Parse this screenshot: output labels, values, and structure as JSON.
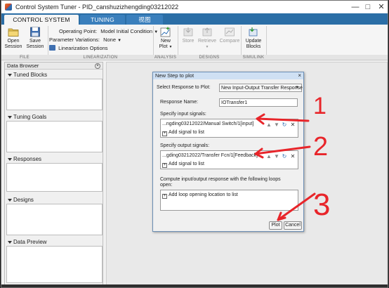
{
  "window": {
    "title": "Control System Tuner - PID_canshuzizhengding03212022"
  },
  "tabs": [
    "CONTROL SYSTEM",
    "TUNING",
    "视图"
  ],
  "toolstrip": {
    "open_session": "Open\nSession",
    "save_session": "Save\nSession",
    "operating_point_label": "Operating Point:",
    "operating_point_value": "Model Initial Condition",
    "param_variations_label": "Parameter Variations:",
    "param_variations_value": "None",
    "linearization_options": "Linearization Options",
    "new_plot": "New\nPlot",
    "store": "Store",
    "retrieve": "Retrieve",
    "compare": "Compare",
    "update_blocks": "Update\nBlocks",
    "sections": [
      "FILE",
      "LINEARIZATION",
      "ANALYSIS",
      "DESIGNS",
      "SIMULINK"
    ]
  },
  "data_browser": {
    "title": "Data Browser",
    "sections": [
      "Tuned Blocks",
      "Tuning Goals",
      "Responses",
      "Designs",
      "Data Preview"
    ]
  },
  "dialog": {
    "title": "New Step to plot",
    "select_response_label": "Select Response to Plot:",
    "select_response_value": "New Input-Output Transfer Response",
    "response_name_label": "Response Name:",
    "response_name_value": "IOTransfer1",
    "input_signals_label": "Specify input signals:",
    "input_signal_value": "...ngding03212022/Manual Switch/1[input]",
    "add_signal_input": "Add signal to list",
    "output_signals_label": "Specify output signals:",
    "output_signal_value": "...gding03212022/Transfer Fcn/1[Feedback]",
    "add_signal_output": "Add signal to list",
    "loops_label_line1": "Compute input/output response with the following loops",
    "loops_label_line2": "open:",
    "add_loop_opening": "Add loop opening location to list",
    "plot_button": "Plot",
    "cancel_button": "Cancel"
  },
  "annotations": {
    "numbers": [
      "1",
      "2",
      "3"
    ],
    "color": "#e8252a"
  },
  "colors": {
    "tab_strip": "#2b6ea6",
    "annotation_red": "#e8252a"
  }
}
